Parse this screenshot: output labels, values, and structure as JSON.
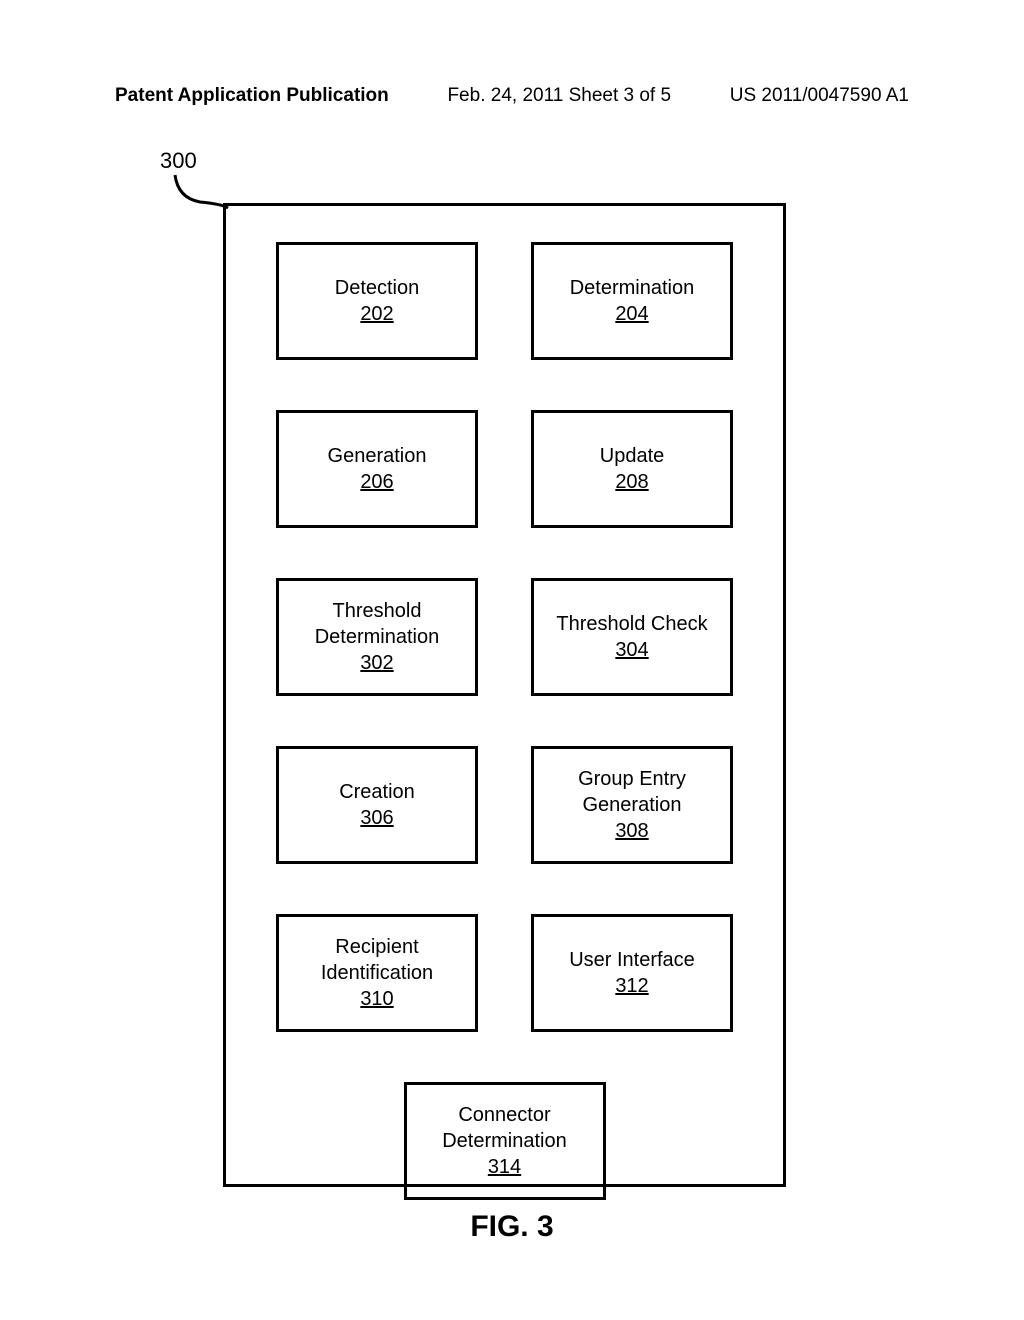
{
  "header": {
    "left": "Patent Application Publication",
    "center": "Feb. 24, 2011  Sheet 3 of 5",
    "right": "US 2011/0047590 A1"
  },
  "refNumber": "300",
  "boxes": {
    "r0c0": {
      "label": "Detection",
      "ref": "202"
    },
    "r0c1": {
      "label": "Determination",
      "ref": "204"
    },
    "r1c0": {
      "label": "Generation",
      "ref": "206"
    },
    "r1c1": {
      "label": "Update",
      "ref": "208"
    },
    "r2c0": {
      "label": "Threshold\nDetermination",
      "ref": "302"
    },
    "r2c1": {
      "label": "Threshold Check",
      "ref": "304"
    },
    "r3c0": {
      "label": "Creation",
      "ref": "306"
    },
    "r3c1": {
      "label": "Group Entry\nGeneration",
      "ref": "308"
    },
    "r4c0": {
      "label": "Recipient\nIdentification",
      "ref": "310"
    },
    "r4c1": {
      "label": "User Interface",
      "ref": "312"
    },
    "r5c0": {
      "label": "Connector\nDetermination",
      "ref": "314"
    }
  },
  "figureLabel": "FIG. 3"
}
